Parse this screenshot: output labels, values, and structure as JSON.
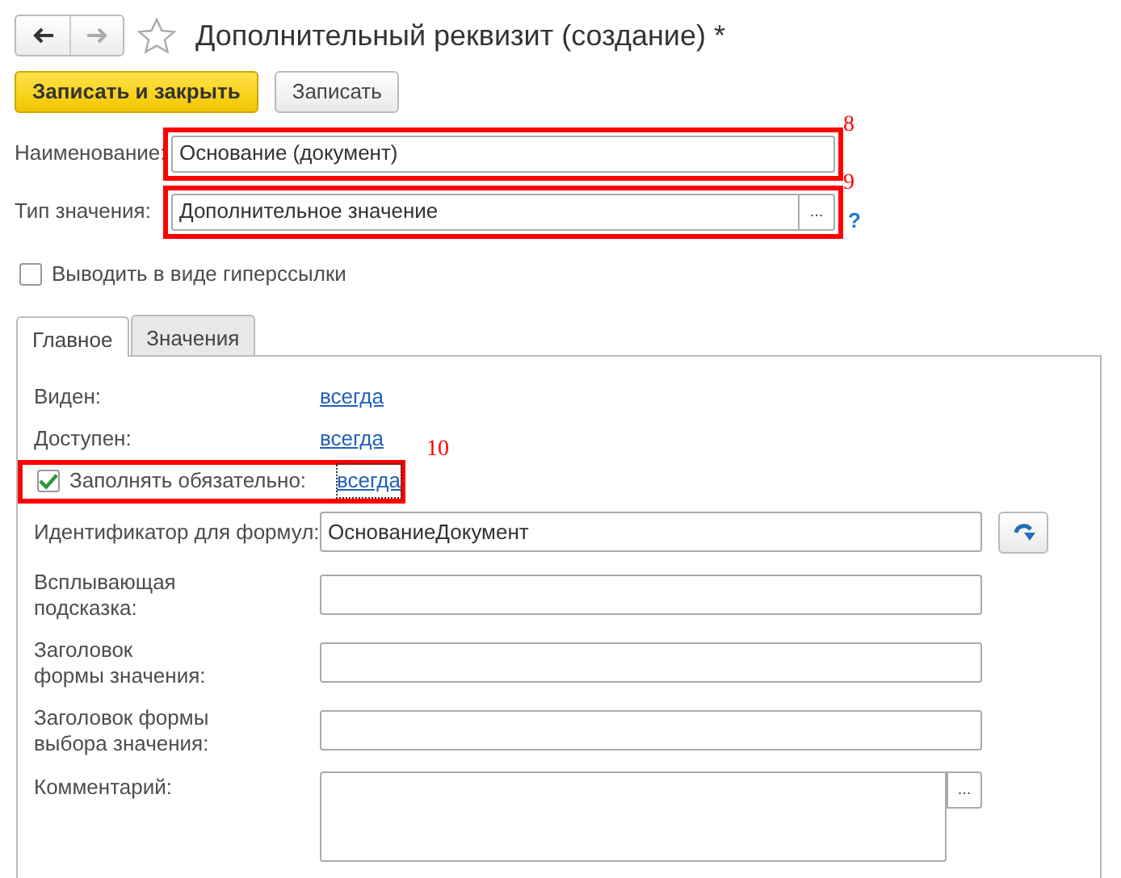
{
  "window": {
    "title": "Дополнительный реквизит (создание) *",
    "back_enabled": true,
    "forward_enabled": false
  },
  "toolbar": [
    {
      "label": "Записать и закрыть",
      "kind": "primary"
    },
    {
      "label": "Записать",
      "kind": "default"
    }
  ],
  "fields": [
    {
      "label": "Наименование:",
      "value": "Основание (документ)",
      "annotation": "8"
    },
    {
      "label": "Тип значения:",
      "value": "Дополнительное значение",
      "choice_button": "...",
      "help": "?",
      "annotation": "9"
    }
  ],
  "hyperlink_checkbox": {
    "label": "Выводить в виде гиперссылки",
    "checked": false
  },
  "tabs": [
    {
      "label": "Главное",
      "selected": true
    },
    {
      "label": "Значения",
      "selected": false
    }
  ],
  "rows": [
    {
      "kind": "link",
      "label_lines": [
        "Виден:"
      ],
      "value": "всегда"
    },
    {
      "kind": "link",
      "label_lines": [
        "Доступен:"
      ],
      "value": "всегда"
    },
    {
      "kind": "check-link",
      "label_lines": [
        "Заполнять обязательно:"
      ],
      "checked": true,
      "value": "всегда",
      "focused": true,
      "annotation": "10"
    },
    {
      "kind": "input",
      "label_lines": [
        "Идентификатор для формул:"
      ],
      "value": "ОснованиеДокумент",
      "action": true
    },
    {
      "kind": "input",
      "label_lines": [
        "Всплывающая",
        "подсказка:"
      ]
    },
    {
      "kind": "input",
      "label_lines": [
        "Заголовок",
        "формы значения:"
      ]
    },
    {
      "kind": "input",
      "label_lines": [
        "Заголовок формы",
        "выбора значения:"
      ]
    },
    {
      "kind": "textarea",
      "label_lines": [
        "Комментарий:"
      ],
      "choice_button": "..."
    }
  ]
}
